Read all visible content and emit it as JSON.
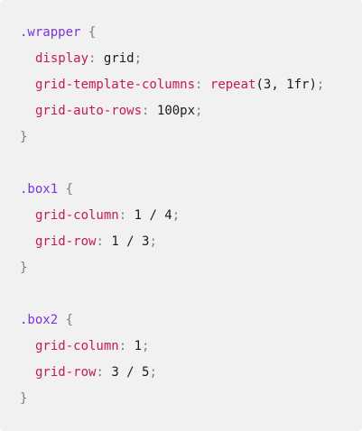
{
  "code": {
    "wrapper": {
      "selector": ".wrapper",
      "open": "{",
      "close": "}",
      "decls": [
        {
          "prop": "display",
          "colon": ":",
          "value": "grid",
          "semi": ";"
        },
        {
          "prop": "grid-template-columns",
          "colon": ":",
          "fn": "repeat",
          "fn_args": "(3, 1fr)",
          "semi": ";"
        },
        {
          "prop": "grid-auto-rows",
          "colon": ":",
          "value": "100px",
          "semi": ";"
        }
      ]
    },
    "box1": {
      "selector": ".box1",
      "open": "{",
      "close": "}",
      "decls": [
        {
          "prop": "grid-column",
          "colon": ":",
          "value": "1 / 4",
          "semi": ";"
        },
        {
          "prop": "grid-row",
          "colon": ":",
          "value": "1 / 3",
          "semi": ";"
        }
      ]
    },
    "box2": {
      "selector": ".box2",
      "open": "{",
      "close": "}",
      "decls": [
        {
          "prop": "grid-column",
          "colon": ":",
          "value": "1",
          "semi": ";"
        },
        {
          "prop": "grid-row",
          "colon": ":",
          "value": "3 / 5",
          "semi": ";"
        }
      ]
    }
  },
  "colors": {
    "background": "#f2f1f2",
    "selector": "#7a33d6",
    "property": "#c4175c",
    "punctuation": "#7c7c7c",
    "text": "#1b1b1b"
  }
}
